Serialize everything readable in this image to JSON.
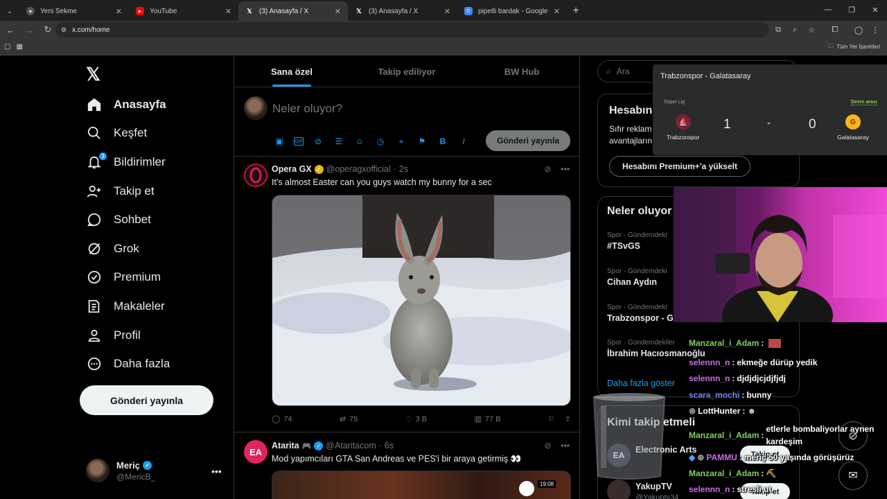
{
  "browser": {
    "tabs": [
      {
        "title": "Yeni Sekme",
        "icon": "chrome-icon",
        "active": false
      },
      {
        "title": "YouTube",
        "icon": "youtube-icon",
        "active": false
      },
      {
        "title": "(3) Anasayfa / X",
        "icon": "x-icon",
        "active": true
      },
      {
        "title": "(3) Anasayfa / X",
        "icon": "x-icon",
        "active": false
      },
      {
        "title": "pipetli bardak - Google Alışveriş",
        "icon": "google-shopping-icon",
        "active": false
      }
    ],
    "url": "x.com/home",
    "bookmarks_folder": "Tüm Yer İşaretleri"
  },
  "sidebar": {
    "items": [
      {
        "label": "Anasayfa",
        "icon": "home-icon",
        "bold": true
      },
      {
        "label": "Keşfet",
        "icon": "search-icon"
      },
      {
        "label": "Bildirimler",
        "icon": "bell-icon",
        "badge": "3"
      },
      {
        "label": "Takip et",
        "icon": "follow-icon"
      },
      {
        "label": "Sohbet",
        "icon": "chat-icon"
      },
      {
        "label": "Grok",
        "icon": "grok-icon"
      },
      {
        "label": "Premium",
        "icon": "premium-icon"
      },
      {
        "label": "Makaleler",
        "icon": "articles-icon"
      },
      {
        "label": "Profil",
        "icon": "profile-icon"
      },
      {
        "label": "Daha fazla",
        "icon": "more-icon"
      }
    ],
    "post_button": "Gönderi yayınla",
    "profile": {
      "name": "Meriç",
      "handle": "@MericB_"
    }
  },
  "timeline": {
    "tabs": [
      "Sana özel",
      "Takip ediliyor",
      "BW Hub"
    ],
    "composer": {
      "placeholder": "Neler oluyor?",
      "post_label": "Gönderi yayınla"
    },
    "tweets": [
      {
        "name": "Opera GX",
        "handle": "@operagxofficial",
        "time": "2s",
        "text": "It's almost Easter can you guys watch my bunny for a sec",
        "replies": "74",
        "reposts": "75",
        "likes": "3 B",
        "views": "77 B"
      },
      {
        "name": "Atarita",
        "handle": "@Ataritacom",
        "time": "6s",
        "text": "Mod yapımcıları GTA San Andreas ve PES'i bir araya getirmiş 👀",
        "video_time": "19:08"
      }
    ]
  },
  "right": {
    "search_placeholder": "Ara",
    "premium_card": {
      "title": "Hesabın",
      "text_1": "Sıfır reklam",
      "text_2": "avantajların",
      "button": "Hesabını Premium+'a yükselt"
    },
    "trends_title": "Neler oluyor",
    "trends": [
      {
        "category": "Spor · Gündemdeki",
        "title": "#TSvGS"
      },
      {
        "category": "Spor · Gündemdeki",
        "title": "Cihan Aydın"
      },
      {
        "category": "Spor · Gündemdeki",
        "title": "Trabzonspor - G"
      },
      {
        "category": "Spor · Gündemdekiler",
        "title": "İbrahim Hacıosmanoğlu"
      }
    ],
    "show_more": "Daha fazla göster",
    "who_to_follow": "Kimi takip etmeli",
    "suggestions": [
      {
        "name": "Electronic Arts",
        "follow": "Takip et"
      },
      {
        "name": "YakupTV",
        "handle": "@Yakuptv34",
        "follow": "Takip et"
      }
    ]
  },
  "scoreboard": {
    "title": "Trabzonspor - Galatasaray",
    "league": "Süper Lig",
    "status": "Devre arası",
    "home": "Trabzonspor",
    "away": "Galatasaray",
    "home_score": "1",
    "separator": "-",
    "away_score": "0"
  },
  "chat": [
    {
      "user": "Manzaral_i_Adam",
      "msg": "",
      "color": "#7ed35c"
    },
    {
      "user": "selennn_n",
      "msg": "ekmeğe dürüp yedik",
      "color": "#c86ee8"
    },
    {
      "user": "selennn_n",
      "msg": "djdjdjcjdjfjdj",
      "color": "#c86ee8"
    },
    {
      "user": "scara_mochi",
      "msg": "bunny",
      "color": "#6e8cff"
    },
    {
      "user": "LottHunter",
      "msg": "",
      "color": "#ffffff"
    },
    {
      "user": "Manzaral_i_Adam",
      "msg": "etlerle bombaliyorlar aynen kardeşim",
      "color": "#7ed35c"
    },
    {
      "user": "PAMMU",
      "msg": "meriç 50 yaşında görüşürüz",
      "color": "#c86ee8"
    },
    {
      "user": "Manzaral_i_Adam",
      "msg": "",
      "color": "#7ed35c"
    },
    {
      "user": "selennn_n",
      "msg": "stresli ut",
      "color": "#c86ee8"
    }
  ]
}
